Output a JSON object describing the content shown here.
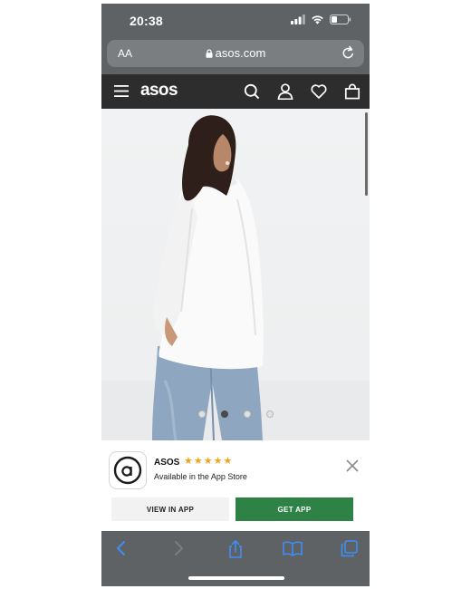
{
  "status_bar": {
    "time": "20:38"
  },
  "browser": {
    "text_size_label": "AA",
    "url": "asos.com"
  },
  "header": {
    "logo": "asos"
  },
  "hero": {
    "image_count": 4,
    "active_index": 1
  },
  "app_banner": {
    "app_name": "ASOS",
    "rating": 5,
    "subtitle": "Available in the App Store",
    "view_button": "VIEW IN APP",
    "get_button": "GET APP"
  },
  "colors": {
    "header_bg": "#2d2d2d",
    "get_app_green": "#2f8245",
    "star": "#f2a51a",
    "browser_chrome": "#5f6264"
  }
}
